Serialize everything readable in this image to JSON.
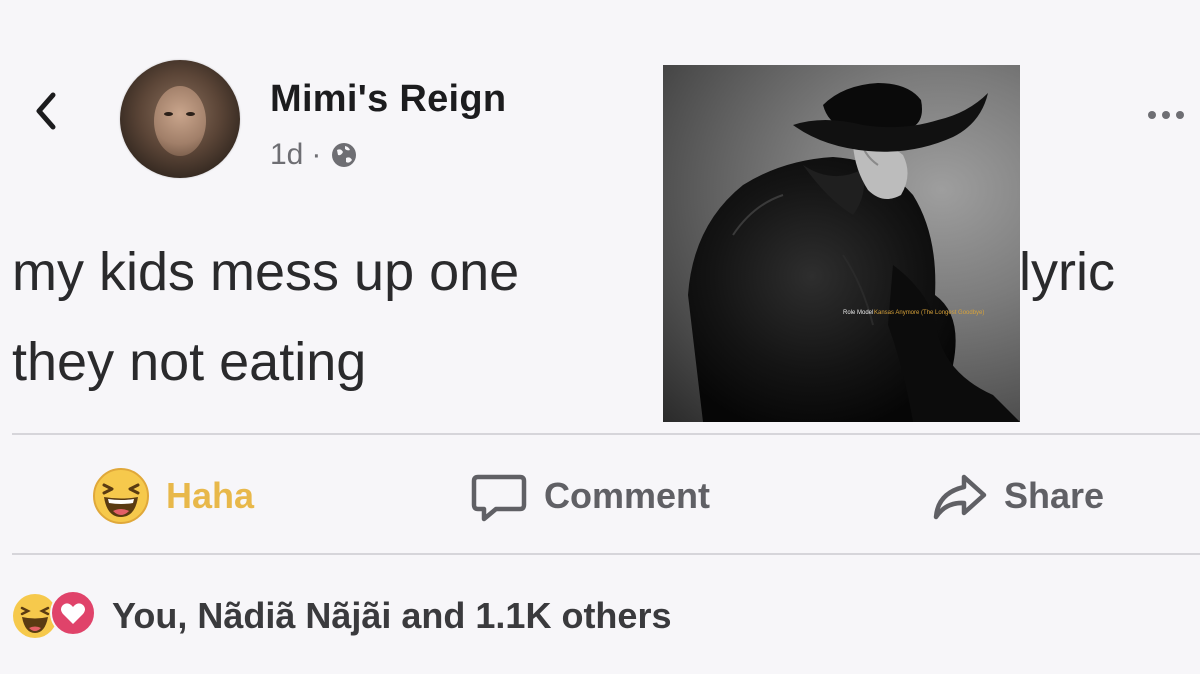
{
  "post": {
    "author": "Mimi's Reign",
    "time": "1d",
    "separator": "·",
    "privacy_icon": "globe-icon",
    "text_line_1_a": "my kids mess up one",
    "text_line_1_b": "lyric",
    "text_line_2": "they not eating"
  },
  "actions": {
    "haha_label": "Haha",
    "comment_label": "Comment",
    "share_label": "Share"
  },
  "reactions": {
    "icons": [
      "haha-icon",
      "love-icon"
    ],
    "summary": "You, Nãdiã Nãjãi and 1.1K others"
  },
  "album_cover": {
    "artist": "Role Model",
    "title": "Kansas Anymore (The Longest Goodbye)"
  },
  "colors": {
    "background": "#f7f6f9",
    "haha_accent": "#e8b84a",
    "love_accent": "#e0436a",
    "album_title": "#d7a23a"
  }
}
